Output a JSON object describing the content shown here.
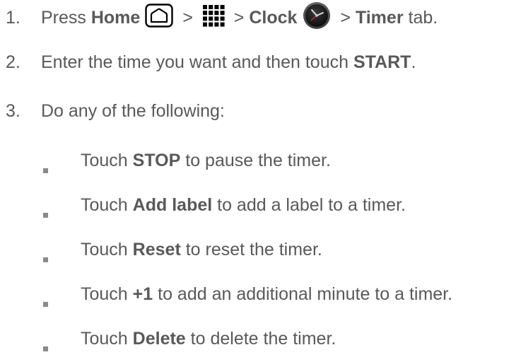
{
  "steps": [
    {
      "num": "1.",
      "parts": {
        "press": "Press ",
        "home": "Home",
        "gt1": " > ",
        "gt2": " > ",
        "clock": "Clock",
        "gt3": " > ",
        "timer": "Timer",
        "tab": " tab."
      }
    },
    {
      "num": "2.",
      "parts": {
        "pre": "Enter the time you want and then touch ",
        "start": "START",
        "post": "."
      }
    },
    {
      "num": "3.",
      "parts": {
        "text": "Do any of the following:"
      }
    }
  ],
  "bullets": [
    {
      "pre": "Touch ",
      "bold": "STOP",
      "post": " to pause the timer."
    },
    {
      "pre": "Touch ",
      "bold": "Add label",
      "post": " to add a label to a timer."
    },
    {
      "pre": "Touch ",
      "bold": "Reset",
      "post": " to reset the timer."
    },
    {
      "pre": "Touch ",
      "bold": "+1",
      "post": " to add an additional minute to a timer."
    },
    {
      "pre": "Touch ",
      "bold": "Delete",
      "post": " to delete the timer."
    }
  ],
  "icons": {
    "home": "home-key-icon",
    "apps": "apps-grid-icon",
    "clock": "clock-app-icon"
  },
  "colors": {
    "text": "#595959",
    "bullet": "#8a8a8a"
  }
}
